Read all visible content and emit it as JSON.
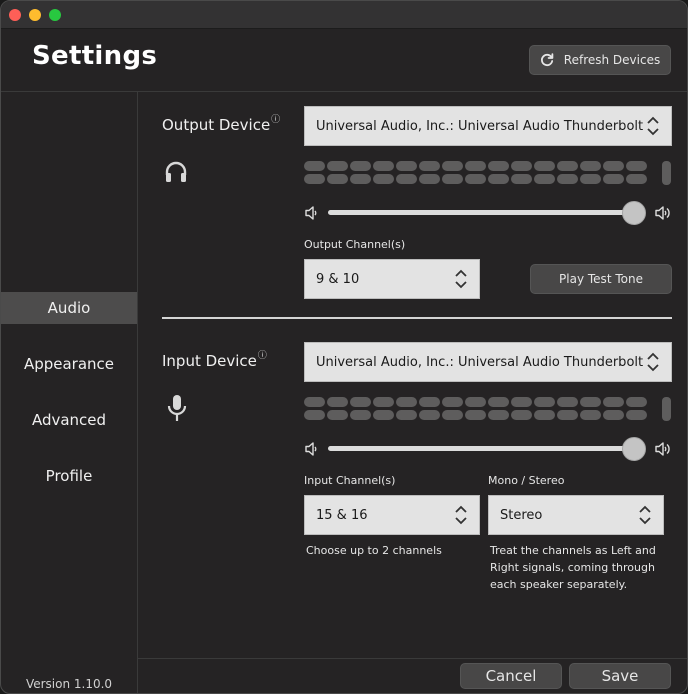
{
  "window": {
    "controls": [
      "close",
      "minimize",
      "zoom"
    ]
  },
  "header": {
    "title": "Settings",
    "refresh_label": "Refresh Devices",
    "refresh_icon": "refresh-icon"
  },
  "sidebar": {
    "items": [
      {
        "label": "Audio",
        "active": true
      },
      {
        "label": "Appearance",
        "active": false
      },
      {
        "label": "Advanced",
        "active": false
      },
      {
        "label": "Profile",
        "active": false
      }
    ],
    "version": "Version 1.10.0"
  },
  "output": {
    "label": "Output Device",
    "help_icon": "?",
    "icon": "headphones-icon",
    "device": "Universal Audio, Inc.: Universal Audio Thunderbolt",
    "meter_segments": 15,
    "meter_rows": 2,
    "volume_percent": 100,
    "channel_label": "Output Channel(s)",
    "channel_value": "9 & 10",
    "test_tone_label": "Play Test Tone"
  },
  "input": {
    "label": "Input Device",
    "help_icon": "?",
    "icon": "microphone-icon",
    "device": "Universal Audio, Inc.: Universal Audio Thunderbolt",
    "meter_segments": 15,
    "meter_rows": 2,
    "volume_percent": 100,
    "channel_label": "Input Channel(s)",
    "channel_value": "15 & 16",
    "channel_hint": "Choose up to 2 channels",
    "mode_label": "Mono / Stereo",
    "mode_value": "Stereo",
    "mode_hint": "Treat the channels as Left and Right signals, coming through each speaker separately."
  },
  "footer": {
    "cancel_label": "Cancel",
    "save_label": "Save"
  }
}
